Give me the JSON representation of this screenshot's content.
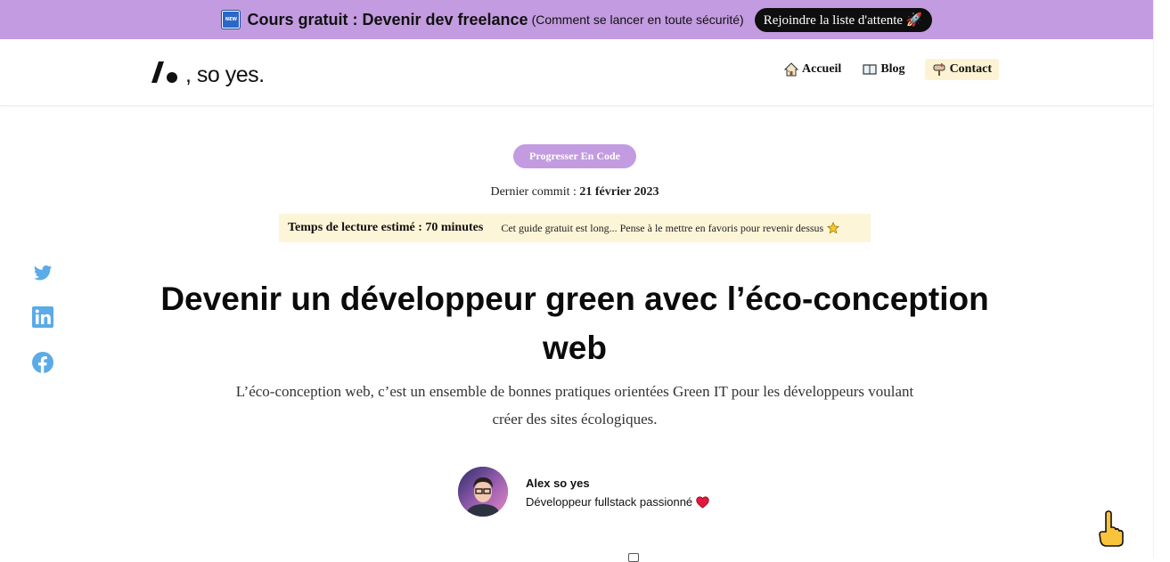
{
  "banner": {
    "badge": "NEW",
    "title": "Cours gratuit : Devenir dev freelance",
    "subtitle": "(Comment se lancer en toute sécurité)",
    "cta": "Rejoindre la liste d'attente 🚀"
  },
  "header": {
    "logo_text": ", so yes.",
    "nav": [
      {
        "label": "Accueil",
        "icon": "house-icon"
      },
      {
        "label": "Blog",
        "icon": "book-icon"
      },
      {
        "label": "Contact",
        "icon": "mailbox-icon"
      }
    ]
  },
  "article": {
    "tag": "Progresser En Code",
    "commit_prefix": "Dernier commit :",
    "commit_date": "21 février 2023",
    "reading_time": "Temps de lecture estimé : 70 minutes",
    "reading_note": "Cet guide gratuit est long... Pense à le mettre en favoris pour revenir dessus",
    "title": "Devenir un développeur green avec l’éco-conception web",
    "lead": "L’éco-conception web, c’est un ensemble de bonnes pratiques orientées Green IT pour les développeurs voulant créer des sites écologiques.",
    "author_name": "Alex so yes",
    "author_role": "Développeur fullstack passionné"
  },
  "social": [
    "twitter-icon",
    "linkedin-icon",
    "facebook-icon"
  ],
  "colors": {
    "banner_bg": "#c39be0",
    "tag_bg": "#c39be0",
    "reading_bg": "#fdf5d8",
    "contact_bg": "#fdf3d4",
    "social_blue": "#5aabe6"
  }
}
